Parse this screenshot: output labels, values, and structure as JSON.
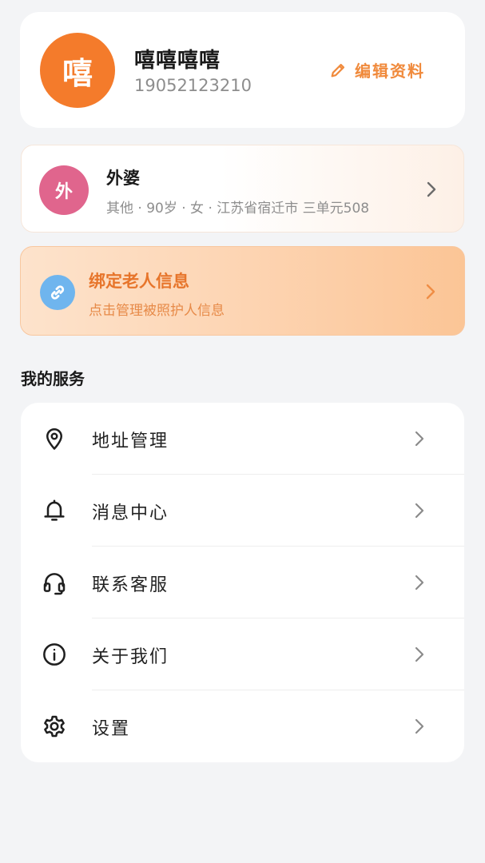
{
  "profile": {
    "avatar_char": "嘻",
    "name": "嘻嘻嘻嘻",
    "phone": "19052123210",
    "edit_label": "编辑资料",
    "avatar_color": "#f47b2b",
    "accent_color": "#f08a3c"
  },
  "elder": {
    "avatar_char": "外",
    "name": "外婆",
    "info": "其他 · 90岁 · 女 · 江苏省宿迁市 三单元508",
    "avatar_color": "#e0658d"
  },
  "bind": {
    "title": "绑定老人信息",
    "subtitle": "点击管理被照护人信息",
    "icon": "link-icon"
  },
  "services": {
    "title": "我的服务",
    "items": [
      {
        "label": "地址管理",
        "icon": "location-pin-icon"
      },
      {
        "label": "消息中心",
        "icon": "bell-icon"
      },
      {
        "label": "联系客服",
        "icon": "headset-icon"
      },
      {
        "label": "关于我们",
        "icon": "info-icon"
      },
      {
        "label": "设置",
        "icon": "gear-icon"
      }
    ]
  }
}
